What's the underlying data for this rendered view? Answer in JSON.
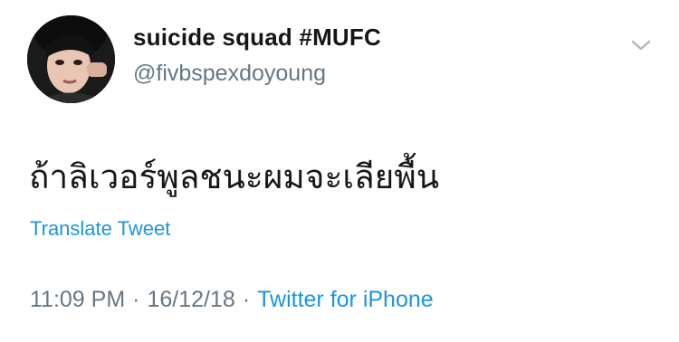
{
  "tweet": {
    "display_name": "suicide squad #MUFC",
    "handle": "@fivbspexdoyoung",
    "text": "ถ้าลิเวอร์พูลชนะผมจะเลียพื้น",
    "translate_label": "Translate Tweet",
    "time": "11:09 PM",
    "date": "16/12/18",
    "separator": "·",
    "source": "Twitter for iPhone"
  },
  "icons": {
    "avatar": "profile-photo",
    "menu": "chevron-down-icon"
  },
  "colors": {
    "text": "#14171a",
    "secondary": "#657786",
    "link": "#1b95e0",
    "background": "#ffffff"
  }
}
